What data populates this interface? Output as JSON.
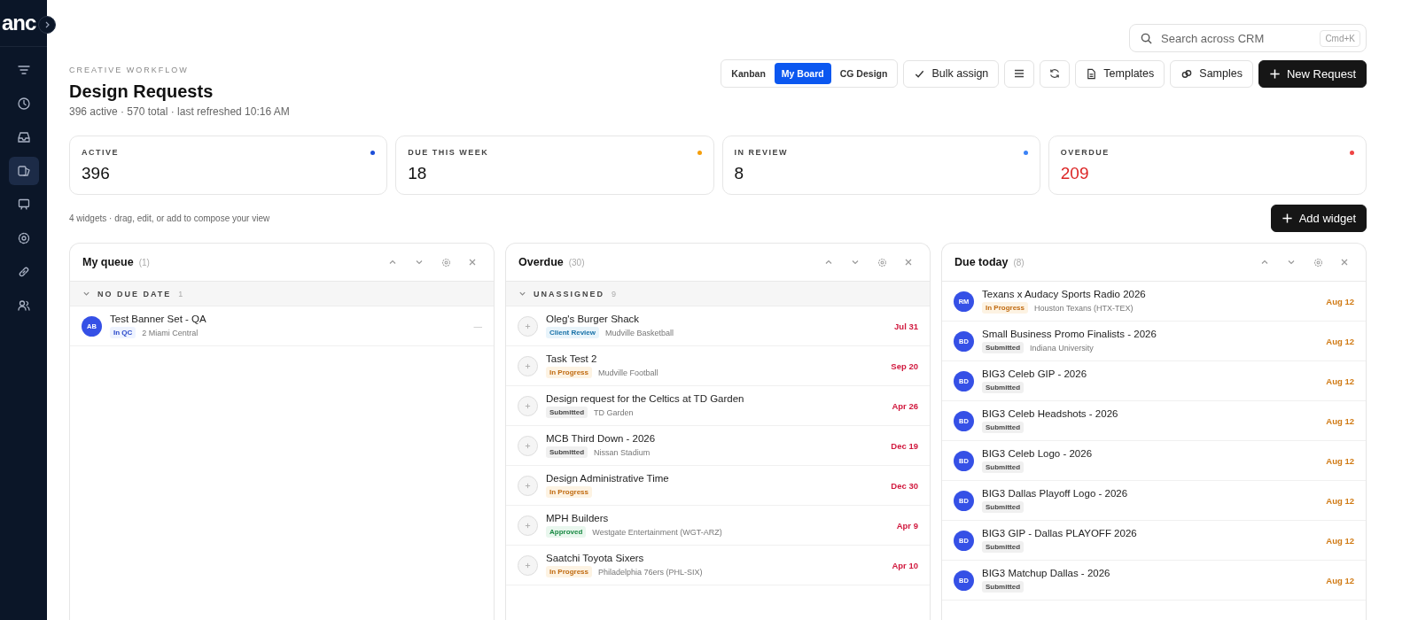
{
  "sidebar": {
    "logo": "anc",
    "items": [
      {
        "selected": false
      },
      {
        "selected": false
      },
      {
        "selected": false
      },
      {
        "selected": true
      },
      {
        "selected": false
      },
      {
        "selected": false
      },
      {
        "selected": false
      },
      {
        "selected": false
      }
    ]
  },
  "search": {
    "placeholder": "Search across CRM",
    "shortcut": "Cmd+K"
  },
  "header": {
    "eyebrow": "CREATIVE WORKFLOW",
    "title": "Design Requests",
    "subtitle": "396 active · 570 total · last refreshed 10:16 AM"
  },
  "view_tabs": [
    {
      "label": "Kanban",
      "selected": false
    },
    {
      "label": "My Board",
      "selected": true
    },
    {
      "label": "CG Design",
      "selected": false
    }
  ],
  "toolbar": [
    {
      "kind": "check",
      "label": "Bulk assign"
    },
    {
      "kind": "menu"
    },
    {
      "kind": "refresh"
    },
    {
      "kind": "file",
      "label": "Templates"
    },
    {
      "kind": "samples",
      "label": "Samples"
    },
    {
      "kind": "primary",
      "label": "New Request"
    }
  ],
  "stats": [
    {
      "label": "ACTIVE",
      "value": "396",
      "color": "#1d4ed8",
      "alert": false
    },
    {
      "label": "DUE THIS WEEK",
      "value": "18",
      "color": "#f59e0b",
      "alert": false
    },
    {
      "label": "IN REVIEW",
      "value": "8",
      "color": "#3b82f6",
      "alert": false
    },
    {
      "label": "OVERDUE",
      "value": "209",
      "color": "#ef4444",
      "alert": true
    }
  ],
  "widgets_note": "4 widgets · drag, edit, or add to compose your view",
  "add_widget": "Add widget",
  "widgets": [
    {
      "title": "My queue",
      "count": "(1)",
      "kind": "queue",
      "groups": [
        {
          "label": "NO DUE DATE",
          "count": "1",
          "expanded": true,
          "items": [
            {
              "avatar": "AB",
              "title": "Test Banner Set - QA",
              "status": "In QC",
              "kind": "qc",
              "client": "2 Miami Central",
              "due": "—"
            }
          ]
        }
      ]
    },
    {
      "title": "Overdue",
      "count": "(30)",
      "kind": "overdue",
      "groups": [
        {
          "label": "UNASSIGNED",
          "count": "9",
          "expanded": true,
          "items": [
            {
              "title": "Oleg's Burger Shack",
              "status": "Client Review",
              "kind": "review",
              "client": "Mudville Basketball",
              "due": "Jul 31"
            },
            {
              "title": "Task Test 2",
              "status": "In Progress",
              "kind": "progress",
              "client": "Mudville Football",
              "due": "Sep 20"
            },
            {
              "title": "Design request for the Celtics at TD Garden",
              "status": "Submitted",
              "kind": "submitted",
              "client": "TD Garden",
              "due": "Apr 26"
            },
            {
              "title": "MCB Third Down - 2026",
              "status": "Submitted",
              "kind": "submitted",
              "client": "Nissan Stadium",
              "due": "Dec 19"
            },
            {
              "title": "Design Administrative Time",
              "status": "In Progress",
              "kind": "progress",
              "due": "Dec 30"
            },
            {
              "title": "MPH Builders",
              "status": "Approved",
              "kind": "approved",
              "client": "Westgate Entertainment (WGT-ARZ)",
              "due": "Apr 9"
            },
            {
              "title": "Saatchi Toyota Sixers",
              "status": "In Progress",
              "kind": "progress",
              "client": "Philadelphia 76ers (PHL-SIX)",
              "due": "Apr 10"
            }
          ]
        }
      ]
    },
    {
      "title": "Due today",
      "count": "(8)",
      "kind": "today",
      "items": [
        {
          "avatar": "RM",
          "title": "Texans x Audacy Sports Radio 2026",
          "status": "In Progress",
          "kind": "progress",
          "client": "Houston Texans (HTX-TEX)",
          "due": "Aug 12"
        },
        {
          "avatar": "BD",
          "title": "Small Business Promo Finalists - 2026",
          "status": "Submitted",
          "kind": "submitted",
          "client": "Indiana University",
          "due": "Aug 12"
        },
        {
          "avatar": "BD",
          "title": "BIG3 Celeb GIP - 2026",
          "status": "Submitted",
          "kind": "submitted",
          "due": "Aug 12"
        },
        {
          "avatar": "BD",
          "title": "BIG3 Celeb Headshots - 2026",
          "status": "Submitted",
          "kind": "submitted",
          "due": "Aug 12"
        },
        {
          "avatar": "BD",
          "title": "BIG3 Celeb Logo - 2026",
          "status": "Submitted",
          "kind": "submitted",
          "due": "Aug 12"
        },
        {
          "avatar": "BD",
          "title": "BIG3 Dallas Playoff Logo - 2026",
          "status": "Submitted",
          "kind": "submitted",
          "due": "Aug 12"
        },
        {
          "avatar": "BD",
          "title": "BIG3 GIP - Dallas PLAYOFF 2026",
          "status": "Submitted",
          "kind": "submitted",
          "due": "Aug 12"
        },
        {
          "avatar": "BD",
          "title": "BIG3 Matchup Dallas - 2026",
          "status": "Submitted",
          "kind": "submitted",
          "due": "Aug 12"
        }
      ]
    }
  ]
}
